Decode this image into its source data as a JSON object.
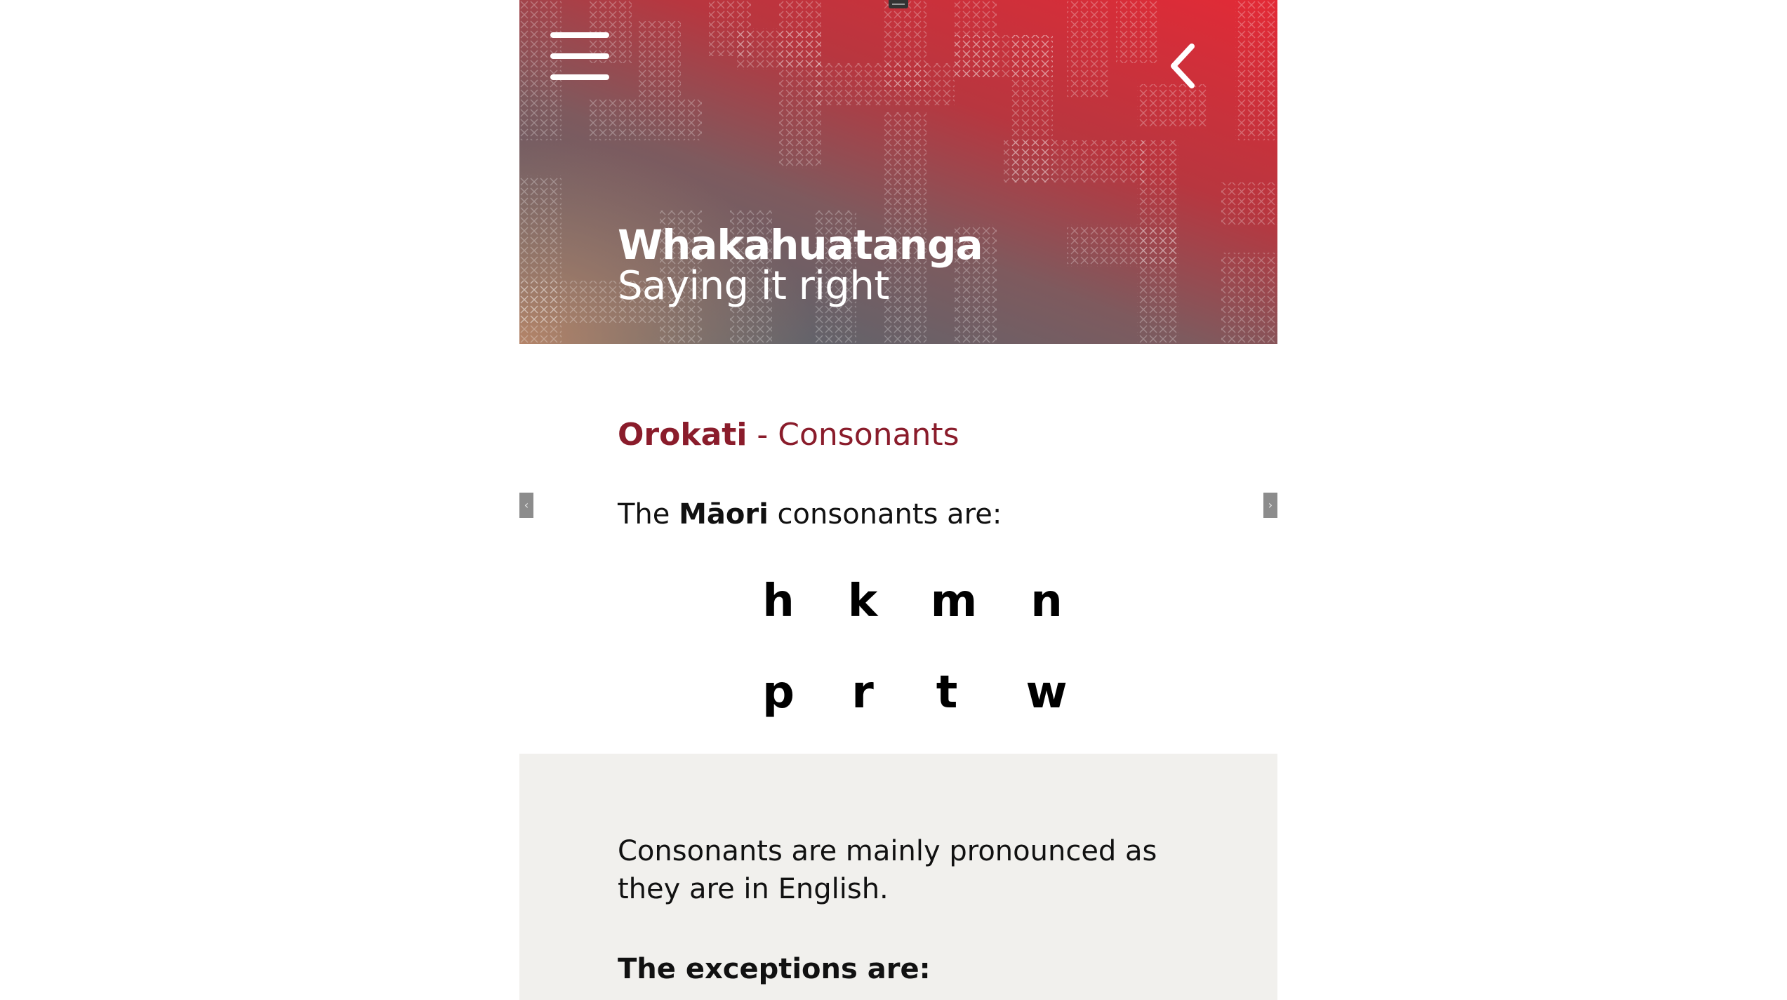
{
  "hero": {
    "title": "Whakahuatanga",
    "subtitle": "Saying it right",
    "menu_icon": "hamburger-menu-icon",
    "back_icon": "chevron-left-icon",
    "gradient_colors": [
      "#e32a36",
      "#b8363f",
      "#7e5a5e",
      "#4f6a74",
      "#d68c64"
    ]
  },
  "section": {
    "title_bold": "Orokati",
    "title_rest": " - Consonants",
    "intro_prefix": "The ",
    "intro_bold": "Māori",
    "intro_suffix": " consonants are:",
    "title_color": "#8a1c2b"
  },
  "carousel": {
    "prev_label": "‹",
    "next_label": "›"
  },
  "consonants": {
    "row1": [
      "h",
      "k",
      "m",
      "n"
    ],
    "row2": [
      "p",
      "r",
      "t",
      "w"
    ]
  },
  "info": {
    "text": "Consonants are mainly pronounced as they are in English.",
    "exceptions_heading": "The exceptions are:",
    "background_color": "#f1f0ed"
  }
}
